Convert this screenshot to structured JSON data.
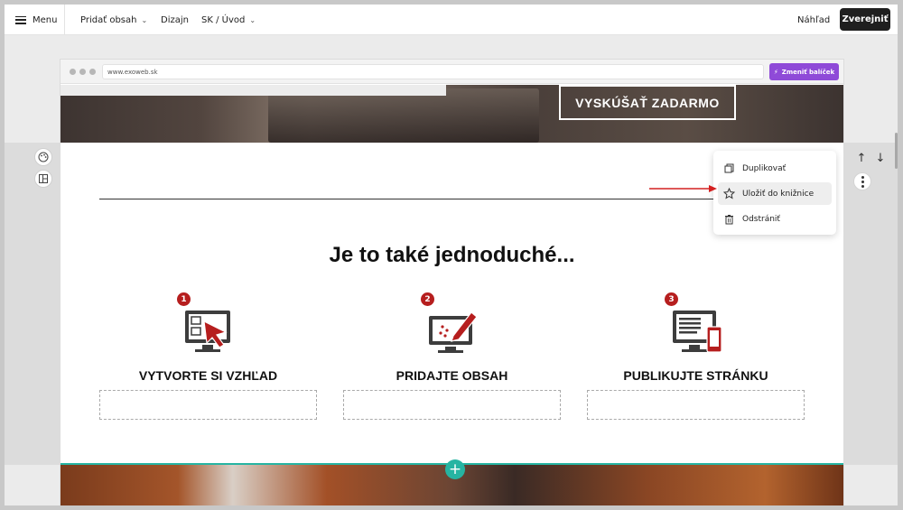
{
  "topbar": {
    "menu_label": "Menu",
    "add_content_label": "Pridať obsah",
    "design_label": "Dizajn",
    "page_selector_label": "SK / Úvod",
    "preview_label": "Náhľad",
    "publish_label": "Zverejniť"
  },
  "browser": {
    "url": "www.exoweb.sk",
    "change_plan_label": "Zmeniť balíček"
  },
  "page": {
    "hero_button_label": "VYSKÚŠAŤ ZADARMO",
    "headline": "Je to také jednoduché...",
    "steps": [
      {
        "number": "1",
        "title": "VYTVORTE SI VZHĽAD",
        "icon": "monitor-cursor-icon"
      },
      {
        "number": "2",
        "title": "PRIDAJTE OBSAH",
        "icon": "monitor-pencil-icon"
      },
      {
        "number": "3",
        "title": "PUBLIKUJTE STRÁNKU",
        "icon": "monitor-phone-icon"
      }
    ]
  },
  "context_menu": {
    "items": [
      {
        "label": "Duplikovať",
        "icon": "copy-icon"
      },
      {
        "label": "Uložiť do knižnice",
        "icon": "star-icon",
        "highlighted": true
      },
      {
        "label": "Odstrániť",
        "icon": "trash-icon"
      }
    ]
  },
  "colors": {
    "accent_purple": "#8f4ad8",
    "step_red": "#b61e1e",
    "add_teal": "#26b4a2",
    "publish_dark": "#1f1f1f"
  }
}
